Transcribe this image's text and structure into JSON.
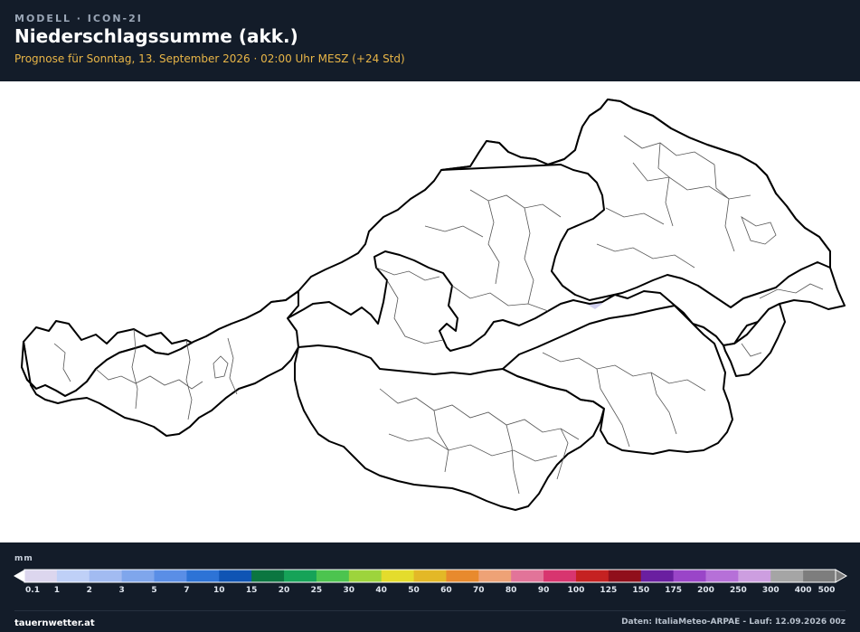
{
  "header": {
    "model": "MODELL · ICON-2I",
    "title": "Niederschlagssumme (akk.)",
    "subtitle": "Prognose für Sonntag, 13. September 2026 · 02:00 Uhr MESZ  (+24 Std)"
  },
  "map": {
    "region": "Österreich",
    "precipitation_color": "#c9c8ee"
  },
  "legend": {
    "unit": "mm",
    "ticks": [
      "0.1",
      "1",
      "2",
      "3",
      "5",
      "7",
      "10",
      "15",
      "20",
      "25",
      "30",
      "40",
      "50",
      "60",
      "70",
      "80",
      "90",
      "100",
      "125",
      "150",
      "175",
      "200",
      "250",
      "300",
      "400",
      "500"
    ],
    "colors": [
      "#dcd6ee",
      "#bfd0f7",
      "#a2bbf1",
      "#7fa6ec",
      "#5a8ee6",
      "#2d73d6",
      "#0f54b4",
      "#0b7640",
      "#16a358",
      "#4cc44f",
      "#9dd43c",
      "#e4dc2c",
      "#e3b827",
      "#e88a2d",
      "#eea276",
      "#e27499",
      "#d8356f",
      "#c52121",
      "#900f1b",
      "#6a1fa0",
      "#9a45c8",
      "#b670d8",
      "#cd9ee0",
      "#a5a5a5",
      "#7d7d7d"
    ]
  },
  "footer": {
    "brand": "tauernwetter.at",
    "credit": "Daten: ItaliaMeteo-ARPAE - Lauf: 12.09.2026 00z"
  }
}
